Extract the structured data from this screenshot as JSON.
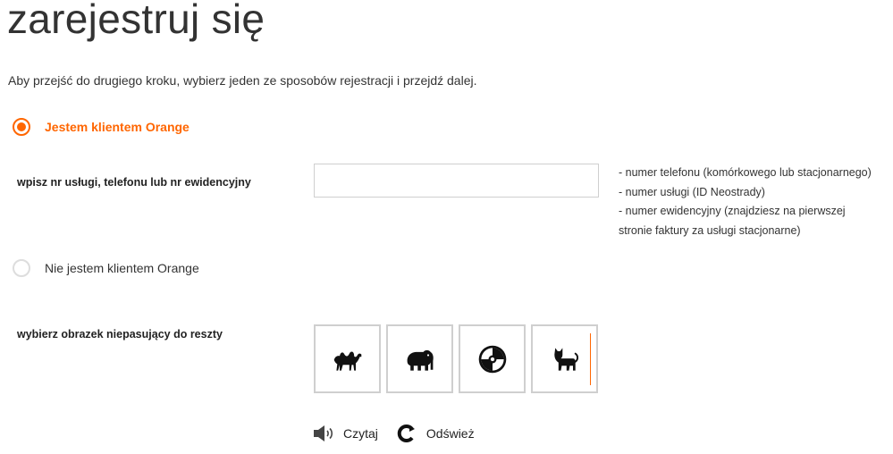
{
  "page": {
    "title": "zarejestruj się",
    "intro": "Aby przejść do drugiego kroku, wybierz jeden ze sposobów rejestracji i przejdź dalej."
  },
  "options": {
    "client": {
      "label": "Jestem klientem Orange",
      "checked": true
    },
    "non_client": {
      "label": "Nie jestem klientem Orange",
      "checked": false
    }
  },
  "service_field": {
    "label": "wpisz nr usługi, telefonu lub nr ewidencyjny",
    "value": "",
    "hints": [
      "- numer telefonu (komórkowego lub stacjonarnego)",
      "- numer usługi (ID Neostrady)",
      "- numer ewidencyjny (znajdziesz na pierwszej",
      "stronie faktury za usługi stacjonarne)"
    ]
  },
  "captcha": {
    "label": "wybierz obrazek niepasujący do reszty",
    "tiles": [
      "camel-icon",
      "elephant-icon",
      "cd-icon",
      "cat-icon"
    ],
    "read_label": "Czytaj",
    "refresh_label": "Odśwież"
  },
  "colors": {
    "accent": "#ff6600",
    "border": "#cfcfcf",
    "text": "#333333"
  }
}
